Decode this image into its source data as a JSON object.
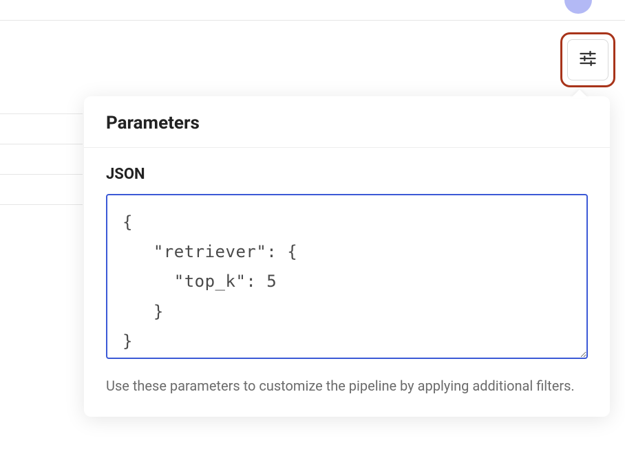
{
  "popover": {
    "title": "Parameters",
    "json_label": "JSON",
    "json_value": "{\n   \"retriever\": {\n     \"top_k\": 5\n   }\n}",
    "helper_text": "Use these parameters to customize the pipeline by applying additional filters."
  }
}
